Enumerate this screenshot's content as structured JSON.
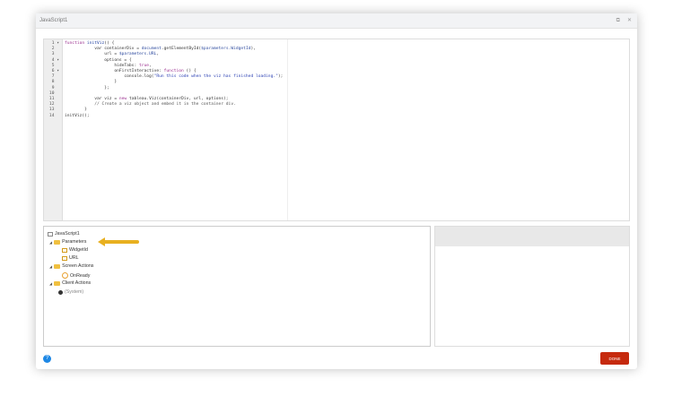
{
  "dialog": {
    "title": "JavaScript1",
    "done_label": "DONE",
    "help_label": "?"
  },
  "editor": {
    "lines": [
      {
        "n": "1",
        "fold": "▾",
        "html": "<span class='kw'>function</span> <span class='bl'>initViz</span>() {"
      },
      {
        "n": "2",
        "fold": "",
        "html": "            var containerDiv = <span class='vr'>document</span>.getElementById(<span class='vr'>$parameters.WidgetId</span>),"
      },
      {
        "n": "3",
        "fold": "",
        "html": "                url = <span class='vr'>$parameters.URL</span>,"
      },
      {
        "n": "4",
        "fold": "▾",
        "html": "                options = {"
      },
      {
        "n": "5",
        "fold": "",
        "html": "                    hideTabs: <span class='kw'>true</span>,"
      },
      {
        "n": "6",
        "fold": "▾",
        "html": "                    onFirstInteractive: <span class='kw'>function</span> () {"
      },
      {
        "n": "7",
        "fold": "",
        "html": "                        console.log(<span class='st'>\"Run this code when the viz has finished loading.\"</span>);"
      },
      {
        "n": "8",
        "fold": "",
        "html": "                    }"
      },
      {
        "n": "9",
        "fold": "",
        "html": "                };"
      },
      {
        "n": "10",
        "fold": "",
        "html": ""
      },
      {
        "n": "11",
        "fold": "",
        "html": "            var viz = <span class='kw'>new</span> tableau.Viz(containerDiv, url, options);"
      },
      {
        "n": "12",
        "fold": "",
        "html": "            <span class='cm'>// Create a viz object and embed it in the container div.</span>"
      },
      {
        "n": "13",
        "fold": "",
        "html": "        }"
      },
      {
        "n": "14",
        "fold": "",
        "html": "initViz();"
      }
    ]
  },
  "tree": {
    "root": "JavaScript1",
    "parameters": "Parameters",
    "widgetid": "WidgetId",
    "url": "URL",
    "screen_actions": "Screen Actions",
    "onready": "OnReady",
    "client_actions": "Client Actions",
    "system": "(System)"
  },
  "colors": {
    "done": "#c62a0e",
    "arrow": "#e8b020",
    "help": "#1e88e5"
  }
}
